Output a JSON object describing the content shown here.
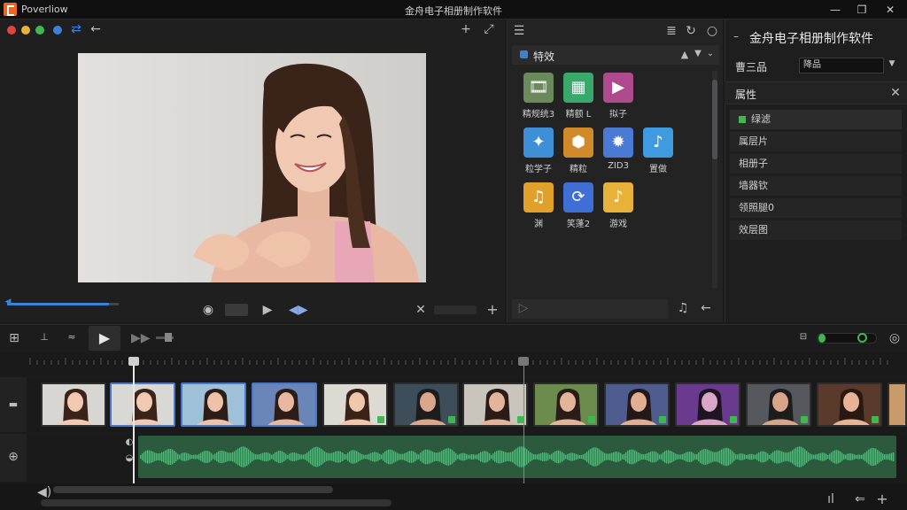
{
  "app": {
    "name": "Poverliow",
    "window_title": "金舟电子相册制作软件"
  },
  "window_controls": {
    "minimize": "—",
    "restore": "❐",
    "close": "✕"
  },
  "effects": {
    "header_label": "特效",
    "items": [
      {
        "label": "精规统3",
        "icon": "film-clapper-icon",
        "color": "#6b8a5b"
      },
      {
        "label": "精额 L",
        "icon": "clapperboard-icon",
        "color": "#3aa86b"
      },
      {
        "label": "拟子",
        "icon": "play-video-icon",
        "color": "#b04a8e"
      },
      {
        "label": "粒学子",
        "icon": "magic-wand-icon",
        "color": "#3f8fd6"
      },
      {
        "label": "精粒",
        "icon": "hexagon-effect-icon",
        "color": "#d08a2a"
      },
      {
        "label": "ZID3",
        "icon": "puzzle-gear-icon",
        "color": "#4a7bd4"
      },
      {
        "label": "置做",
        "icon": "music-note-icon",
        "color": "#3f9be0"
      },
      {
        "label": "渊",
        "icon": "audio-file-icon",
        "color": "#e0a02a"
      },
      {
        "label": "笑蓬2",
        "icon": "transition-loop-icon",
        "color": "#3f6fd4"
      },
      {
        "label": "游戏",
        "icon": "music-note-icon",
        "color": "#e8b23a"
      }
    ]
  },
  "properties": {
    "title": "金舟电子相册制作软件",
    "preset_label": "曹三品",
    "preset_value": "降品",
    "section": "属性",
    "items": [
      "绿滤",
      "属层片",
      "相册子",
      "墙器钦",
      "领照腿0",
      "效层图"
    ]
  },
  "timeline": {
    "clip_count": 13,
    "playhead_percent": 0.12,
    "marker_percent": 0.57
  },
  "colors": {
    "accent": "#3b82d6",
    "selection": "#4a78c8",
    "waveform": "#57b37c"
  }
}
